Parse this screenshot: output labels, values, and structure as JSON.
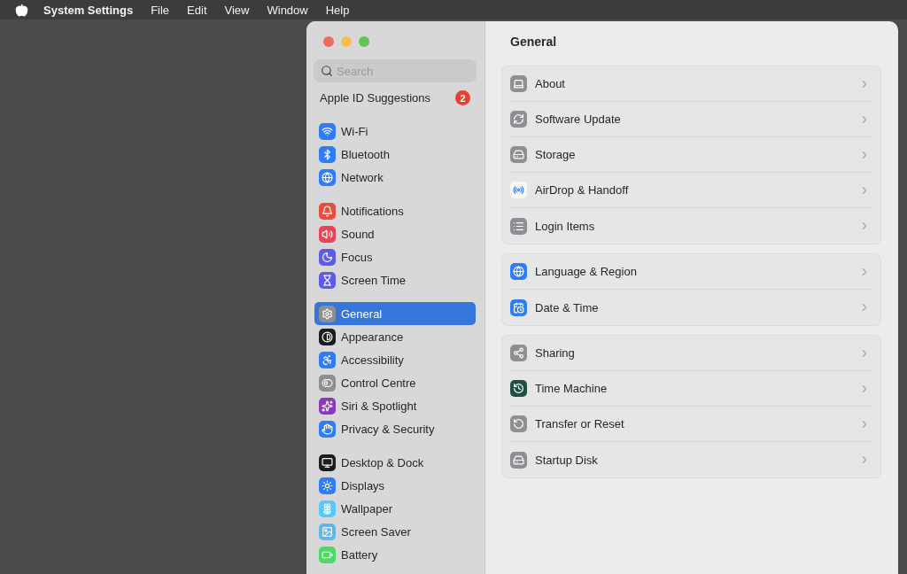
{
  "menu_bar": {
    "app_name": "System Settings",
    "items": [
      "File",
      "Edit",
      "View",
      "Window",
      "Help"
    ]
  },
  "sidebar": {
    "search": {
      "placeholder": "Search"
    },
    "apple_id": {
      "label": "Apple ID Suggestions",
      "badge": "2"
    },
    "groups": [
      [
        {
          "label": "Wi-Fi",
          "color": "#2f7cf6",
          "selected": false
        },
        {
          "label": "Bluetooth",
          "color": "#2f7cf6",
          "selected": false
        },
        {
          "label": "Network",
          "color": "#2f7cf6",
          "selected": false
        }
      ],
      [
        {
          "label": "Notifications",
          "color": "#eb4d3d",
          "selected": false
        },
        {
          "label": "Sound",
          "color": "#e8445a",
          "selected": false
        },
        {
          "label": "Focus",
          "color": "#5e5ce6",
          "selected": false
        },
        {
          "label": "Screen Time",
          "color": "#5e5ce6",
          "selected": false
        }
      ],
      [
        {
          "label": "General",
          "color": "#8e8e93",
          "selected": true
        },
        {
          "label": "Appearance",
          "color": "#1c1c1e",
          "selected": false
        },
        {
          "label": "Accessibility",
          "color": "#2f7cf6",
          "selected": false
        },
        {
          "label": "Control Centre",
          "color": "#8e8e93",
          "selected": false
        },
        {
          "label": "Siri & Spotlight",
          "color": "#8a3ab9",
          "selected": false
        },
        {
          "label": "Privacy & Security",
          "color": "#2f7cf6",
          "selected": false
        }
      ],
      [
        {
          "label": "Desktop & Dock",
          "color": "#1c1c1e",
          "selected": false
        },
        {
          "label": "Displays",
          "color": "#2f7cf6",
          "selected": false
        },
        {
          "label": "Wallpaper",
          "color": "#5ac8fa",
          "selected": false
        },
        {
          "label": "Screen Saver",
          "color": "#64b5e8",
          "selected": false
        },
        {
          "label": "Battery",
          "color": "#4cd964",
          "selected": false
        }
      ]
    ]
  },
  "content": {
    "title": "General",
    "groups": [
      [
        {
          "label": "About"
        },
        {
          "label": "Software Update"
        },
        {
          "label": "Storage"
        },
        {
          "label": "AirDrop & Handoff"
        },
        {
          "label": "Login Items"
        }
      ],
      [
        {
          "label": "Language & Region"
        },
        {
          "label": "Date & Time"
        }
      ],
      [
        {
          "label": "Sharing"
        },
        {
          "label": "Time Machine"
        },
        {
          "label": "Transfer or Reset"
        },
        {
          "label": "Startup Disk"
        }
      ]
    ]
  }
}
